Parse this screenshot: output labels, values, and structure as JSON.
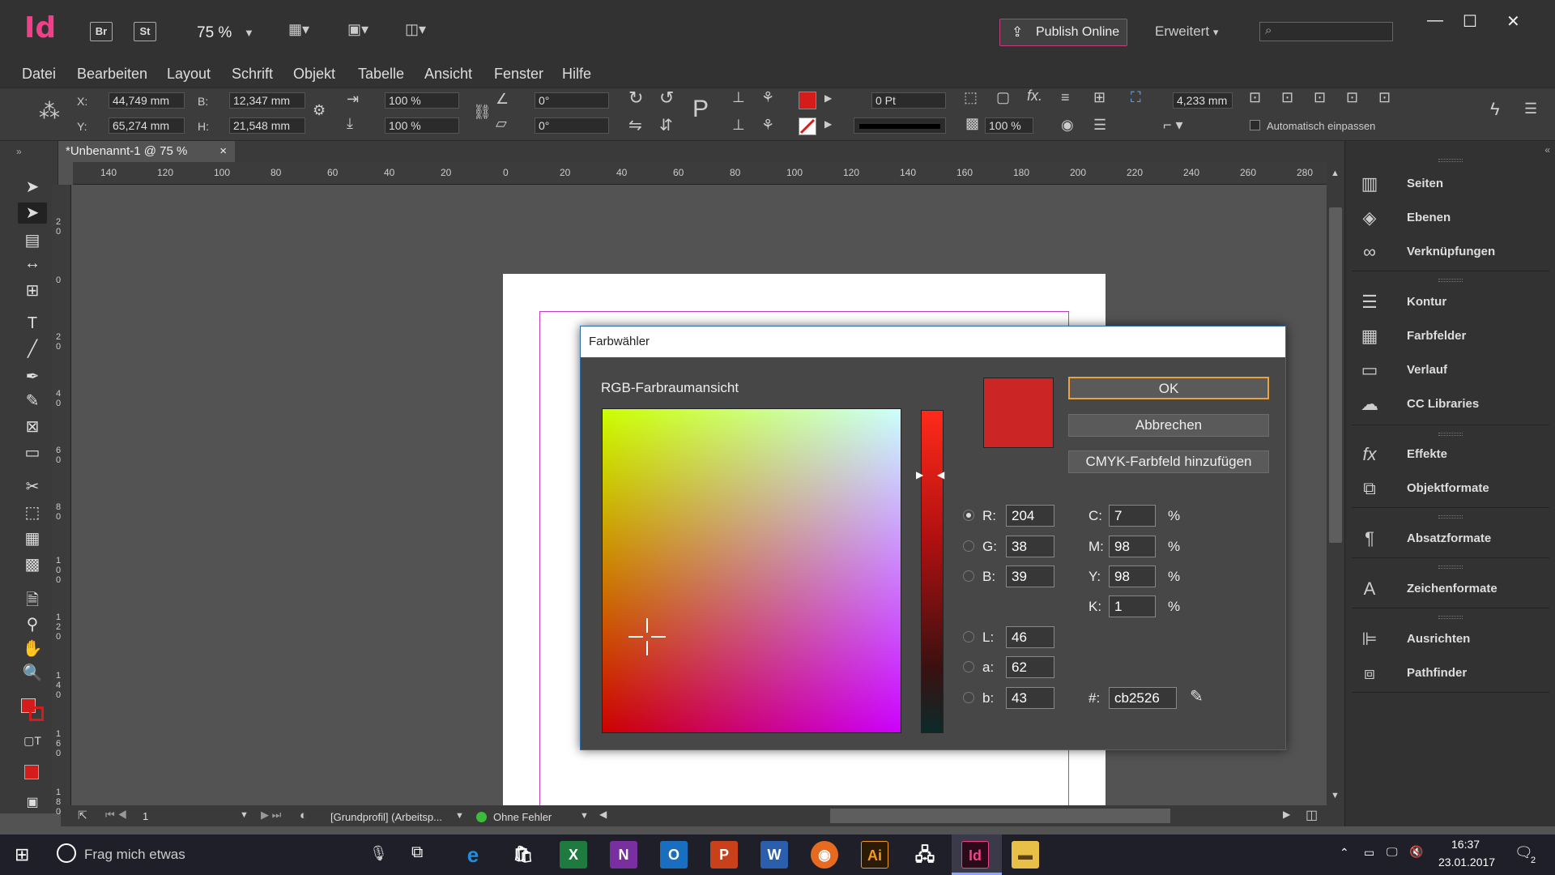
{
  "app": {
    "logo": "Id",
    "bridge": "Br",
    "stock": "St",
    "zoom": "75 %"
  },
  "header": {
    "publish_label": "Publish Online",
    "workspace": "Erweitert"
  },
  "menu": [
    "Datei",
    "Bearbeiten",
    "Layout",
    "Schrift",
    "Objekt",
    "Tabelle",
    "Ansicht",
    "Fenster",
    "Hilfe"
  ],
  "control": {
    "x_label": "X:",
    "x": "44,749 mm",
    "y_label": "Y:",
    "y": "65,274 mm",
    "w_label": "B:",
    "w": "12,347 mm",
    "h_label": "H:",
    "h": "21,548 mm",
    "scale_x": "100 %",
    "scale_y": "100 %",
    "rotate": "0°",
    "shear": "0°",
    "stroke_weight": "0 Pt",
    "opacity": "100 %",
    "offset": "4,233 mm",
    "autofit": "Automatisch einpassen"
  },
  "document": {
    "tab_title": "*Unbenannt-1 @ 75 %",
    "close": "×"
  },
  "ruler": {
    "h_ticks": [
      "140",
      "120",
      "100",
      "80",
      "60",
      "40",
      "20",
      "0",
      "20",
      "40",
      "60",
      "80",
      "100",
      "120",
      "140",
      "160",
      "180",
      "200",
      "220",
      "240",
      "260",
      "280"
    ],
    "v_ticks": [
      "2 0",
      "0",
      "2 0",
      "4 0",
      "6 0",
      "8 0",
      "1 0 0",
      "1 2 0",
      "1 4 0",
      "1 6 0",
      "1 8 0"
    ]
  },
  "status": {
    "page": "1",
    "profile": "[Grundprofil] (Arbeitsp...",
    "preflight": "Ohne Fehler"
  },
  "panels": [
    "Seiten",
    "Ebenen",
    "Verknüpfungen",
    "Kontur",
    "Farbfelder",
    "Verlauf",
    "CC Libraries",
    "Effekte",
    "Objektformate",
    "Absatzformate",
    "Zeichenformate",
    "Ausrichten",
    "Pathfinder"
  ],
  "dialog": {
    "title": "Farbwähler",
    "view_label": "RGB-Farbraumansicht",
    "ok": "OK",
    "cancel": "Abbrechen",
    "add_swatch": "CMYK-Farbfeld hinzufügen",
    "swatch_color": "#cb2526",
    "rgb": [
      {
        "label": "R:",
        "value": "204"
      },
      {
        "label": "G:",
        "value": "38"
      },
      {
        "label": "B:",
        "value": "39"
      }
    ],
    "lab": [
      {
        "label": "L:",
        "value": "46"
      },
      {
        "label": "a:",
        "value": "62"
      },
      {
        "label": "b:",
        "value": "43"
      }
    ],
    "cmyk": [
      {
        "label": "C:",
        "value": "7",
        "unit": "%"
      },
      {
        "label": "M:",
        "value": "98",
        "unit": "%"
      },
      {
        "label": "Y:",
        "value": "98",
        "unit": "%"
      },
      {
        "label": "K:",
        "value": "1",
        "unit": "%"
      }
    ],
    "hex_label": "#:",
    "hex": "cb2526"
  },
  "taskbar": {
    "search_placeholder": "Frag mich etwas",
    "time": "16:37",
    "date": "23.01.2017",
    "notifications": "2"
  }
}
